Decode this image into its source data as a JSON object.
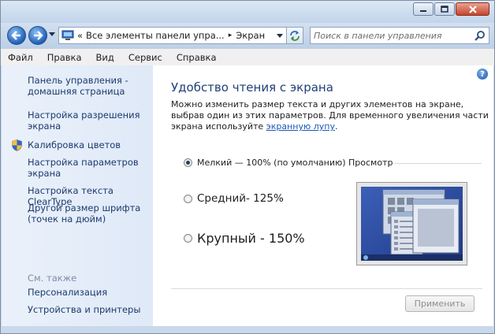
{
  "window": {
    "minimize_icon": "minimize-icon",
    "maximize_icon": "maximize-icon",
    "close_icon": "close-icon"
  },
  "nav": {
    "back_icon": "back-arrow-icon",
    "forward_icon": "forward-arrow-icon",
    "address_prefix": "«",
    "address_crumb1": "Все элементы панели упра...",
    "address_separator": "▸",
    "address_crumb2": "Экран",
    "search_placeholder": "Поиск в панели управления"
  },
  "menu": {
    "items": [
      "Файл",
      "Правка",
      "Вид",
      "Сервис",
      "Справка"
    ]
  },
  "sidebar": {
    "links": [
      {
        "label": "Панель управления - домашняя страница"
      },
      {
        "label": "Настройка разрешения экрана"
      },
      {
        "label": "Калибровка цветов"
      },
      {
        "label": "Настройка параметров экрана"
      },
      {
        "label": "Настройка текста ClearType"
      },
      {
        "label": "Другой размер шрифта (точек на дюйм)"
      }
    ],
    "see_also": "См. также",
    "see_also_links": [
      {
        "label": "Персонализация"
      },
      {
        "label": "Устройства и принтеры"
      }
    ]
  },
  "main": {
    "heading": "Удобство чтения с экрана",
    "description": "Можно изменить размер текста и других элементов на экране, выбрав один из этих параметров. Для временного увеличения части экрана используйте ",
    "description_link": "экранную лупу",
    "description_end": ".",
    "options": [
      {
        "label": "Мелкий — 100% (по умолчанию)",
        "selected": true
      },
      {
        "label": "Средний- 125%",
        "selected": false
      },
      {
        "label": "Крупный - 150%",
        "selected": false
      }
    ],
    "preview_label": "Просмотр",
    "apply_label": "Применить",
    "help_label": "?"
  },
  "colors": {
    "link": "#1c3a6d",
    "heading": "#1e3f78",
    "sidebar_bg": "#e4edf9"
  }
}
